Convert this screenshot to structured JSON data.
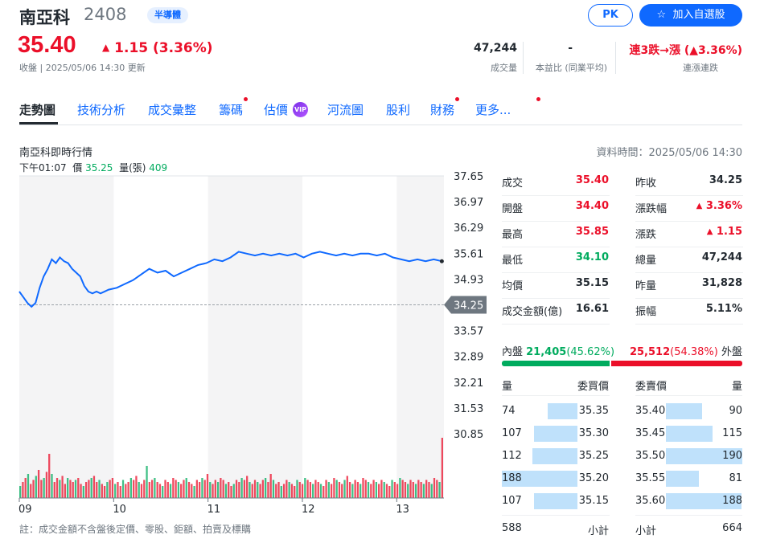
{
  "header": {
    "name": "南亞科",
    "code": "2408",
    "tag": "半導體",
    "pk": "PK",
    "add_watchlist": "加入自選股",
    "star_icon": "star-icon"
  },
  "quote": {
    "price": "35.40",
    "change": "1.15 (3.36%)",
    "status": "收盤 | 2025/05/06 14:30 更新"
  },
  "stats": [
    {
      "value": "47,244",
      "label": "成交量"
    },
    {
      "value": "-",
      "label": "本益比 (同業平均)"
    },
    {
      "value": "連3跌→漲 (▲3.36%)",
      "label": "連漲連跌"
    }
  ],
  "nav": [
    {
      "label": "走勢圖",
      "dot": false
    },
    {
      "label": "技術分析",
      "dot": false
    },
    {
      "label": "成交彙整",
      "dot": false
    },
    {
      "label": "籌碼",
      "dot": true
    },
    {
      "label": "估價",
      "dot": false,
      "vip": "VIP"
    },
    {
      "label": "河流圖",
      "dot": false
    },
    {
      "label": "股利",
      "dot": false
    },
    {
      "label": "財務",
      "dot": true
    },
    {
      "label": "更多...",
      "dot": true
    }
  ],
  "chart_section": {
    "title": "南亞科即時行情",
    "data_time": "資料時間：2025/05/06 14:30",
    "tip": {
      "time": "下午01:07",
      "price_label": "價",
      "price": "35.25",
      "vol_label": "量(張)",
      "vol": "409"
    },
    "footnote": "註：成交金額不含盤後定價、零股、鉅額、拍賣及標購"
  },
  "chart_data": {
    "type": "line",
    "y_ticks": [
      "37.65",
      "36.97",
      "36.29",
      "35.61",
      "34.93",
      "34.25",
      "33.57",
      "32.89",
      "32.21",
      "31.53",
      "30.85"
    ],
    "ylim": [
      30.85,
      37.65
    ],
    "x_ticks": [
      "09",
      "10",
      "11",
      "12",
      "13"
    ],
    "reference": "34.25",
    "last": "35.40",
    "colors": {
      "line": "#0f69ff",
      "up": "#eb0f29",
      "down": "#00ab5e",
      "ref": "#6e7780"
    },
    "series": [
      {
        "values": [
          [
            0,
            34.6
          ],
          [
            1,
            34.45
          ],
          [
            2,
            34.3
          ],
          [
            3,
            34.2
          ],
          [
            4,
            34.3
          ],
          [
            5,
            34.7
          ],
          [
            6,
            35.0
          ],
          [
            7,
            35.2
          ],
          [
            8,
            35.45
          ],
          [
            9,
            35.35
          ],
          [
            10,
            35.5
          ],
          [
            11,
            35.4
          ],
          [
            12,
            35.35
          ],
          [
            13,
            35.2
          ],
          [
            14,
            35.1
          ],
          [
            15,
            35.0
          ],
          [
            16,
            34.75
          ],
          [
            17,
            34.6
          ],
          [
            18,
            34.55
          ],
          [
            19,
            34.6
          ],
          [
            20,
            34.55
          ],
          [
            22,
            34.65
          ],
          [
            24,
            34.7
          ],
          [
            26,
            34.8
          ],
          [
            28,
            34.9
          ],
          [
            30,
            35.05
          ],
          [
            32,
            35.2
          ],
          [
            34,
            35.1
          ],
          [
            36,
            35.15
          ],
          [
            38,
            35.0
          ],
          [
            40,
            35.1
          ],
          [
            42,
            35.2
          ],
          [
            44,
            35.3
          ],
          [
            46,
            35.35
          ],
          [
            48,
            35.45
          ],
          [
            50,
            35.4
          ],
          [
            52,
            35.5
          ],
          [
            54,
            35.65
          ],
          [
            56,
            35.6
          ],
          [
            58,
            35.55
          ],
          [
            60,
            35.6
          ],
          [
            62,
            35.55
          ],
          [
            64,
            35.6
          ],
          [
            66,
            35.55
          ],
          [
            68,
            35.6
          ],
          [
            70,
            35.5
          ],
          [
            72,
            35.6
          ],
          [
            74,
            35.65
          ],
          [
            76,
            35.6
          ],
          [
            78,
            35.55
          ],
          [
            80,
            35.6
          ],
          [
            82,
            35.55
          ],
          [
            84,
            35.6
          ],
          [
            86,
            35.6
          ],
          [
            88,
            35.55
          ],
          [
            90,
            35.6
          ],
          [
            92,
            35.5
          ],
          [
            94,
            35.45
          ],
          [
            96,
            35.4
          ],
          [
            98,
            35.45
          ],
          [
            100,
            35.4
          ],
          [
            102,
            35.45
          ],
          [
            104,
            35.4
          ]
        ]
      }
    ],
    "volumes": [
      6,
      8,
      10,
      12,
      7,
      9,
      11,
      14,
      9,
      10,
      13,
      22,
      12,
      8,
      10,
      9,
      11,
      7,
      10,
      9,
      8,
      9,
      10,
      7,
      6,
      8,
      9,
      10,
      11,
      8,
      9,
      7,
      6,
      8,
      9,
      10,
      7,
      8,
      6,
      9,
      7,
      8,
      10,
      9,
      11,
      8,
      7,
      9,
      16,
      8,
      9,
      10,
      8,
      7,
      6,
      9,
      8,
      7,
      10,
      9,
      8,
      7,
      9,
      10,
      8,
      7,
      6,
      9,
      8,
      10,
      9,
      12,
      8,
      7,
      9,
      8,
      10,
      9,
      7,
      8,
      6,
      7,
      9,
      8,
      10,
      9,
      11,
      8,
      7,
      9,
      8,
      7,
      9,
      10,
      8,
      12,
      9,
      7,
      8,
      6,
      7,
      9,
      8,
      7,
      6,
      9,
      8,
      7,
      10,
      9,
      8,
      7,
      9,
      8,
      7,
      6,
      9,
      8,
      7,
      10,
      9,
      8,
      7,
      9,
      11,
      8,
      7,
      9,
      8,
      7,
      10,
      9,
      8,
      7,
      9,
      8,
      7,
      9,
      8,
      7,
      6,
      9,
      8,
      7,
      10,
      9,
      8,
      7,
      9,
      8,
      7,
      9,
      8,
      7,
      9,
      8,
      7,
      10,
      9,
      8,
      30
    ]
  },
  "quote_table": [
    {
      "label": "成交",
      "value": "35.40",
      "color": "red"
    },
    {
      "label": "昨收",
      "value": "34.25",
      "color": ""
    },
    {
      "label": "開盤",
      "value": "34.40",
      "color": "red"
    },
    {
      "label": "漲跌幅",
      "value": "3.36%",
      "color": "red",
      "arrow": "▲"
    },
    {
      "label": "最高",
      "value": "35.85",
      "color": "red"
    },
    {
      "label": "漲跌",
      "value": "1.15",
      "color": "red",
      "arrow": "▲"
    },
    {
      "label": "最低",
      "value": "34.10",
      "color": "green"
    },
    {
      "label": "總量",
      "value": "47,244",
      "color": ""
    },
    {
      "label": "均價",
      "value": "35.15",
      "color": ""
    },
    {
      "label": "昨量",
      "value": "31,828",
      "color": ""
    },
    {
      "label": "成交金額(億)",
      "value": "16.61",
      "color": ""
    },
    {
      "label": "振幅",
      "value": "5.11%",
      "color": ""
    }
  ],
  "inout": {
    "in_label": "內盤",
    "in_value": "21,405",
    "in_pct": "(45.62%)",
    "out_value": "25,512",
    "out_pct": "(54.38%)",
    "out_label": "外盤",
    "in_fraction": 0.4562
  },
  "orderbook": {
    "headers": {
      "bid_qty": "量",
      "bid_price": "委買價",
      "ask_price": "委賣價",
      "ask_qty": "量"
    },
    "bids": [
      {
        "qty": "74",
        "price": "35.35",
        "share": 0.39
      },
      {
        "qty": "107",
        "price": "35.30",
        "share": 0.57
      },
      {
        "qty": "112",
        "price": "35.25",
        "share": 0.6
      },
      {
        "qty": "188",
        "price": "35.20",
        "share": 1.0
      },
      {
        "qty": "107",
        "price": "35.15",
        "share": 0.57
      }
    ],
    "asks": [
      {
        "price": "35.40",
        "qty": "90",
        "share": 0.47
      },
      {
        "price": "35.45",
        "qty": "115",
        "share": 0.61
      },
      {
        "price": "35.50",
        "qty": "190",
        "share": 1.0
      },
      {
        "price": "35.55",
        "qty": "81",
        "share": 0.43
      },
      {
        "price": "35.60",
        "qty": "188",
        "share": 0.99
      }
    ],
    "bid_total": "588",
    "subtotal_label": "小計",
    "ask_total": "664"
  }
}
